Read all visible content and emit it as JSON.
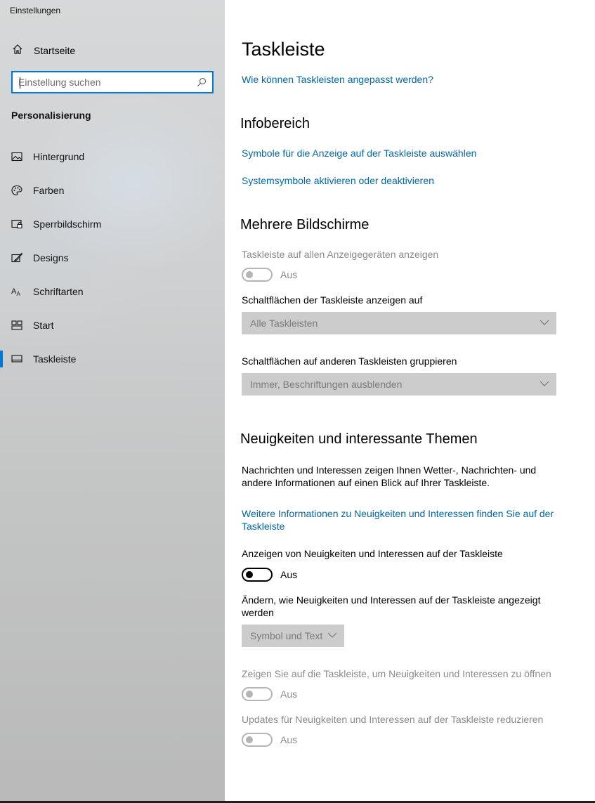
{
  "window": {
    "title": "Einstellungen"
  },
  "sidebar": {
    "home_label": "Startseite",
    "search": {
      "placeholder": "Einstellung suchen",
      "value": ""
    },
    "section_title": "Personalisierung",
    "items": [
      {
        "label": "Hintergrund",
        "icon": "image-icon",
        "selected": false
      },
      {
        "label": "Farben",
        "icon": "palette-icon",
        "selected": false
      },
      {
        "label": "Sperrbildschirm",
        "icon": "lock-screen-icon",
        "selected": false
      },
      {
        "label": "Designs",
        "icon": "brush-icon",
        "selected": false
      },
      {
        "label": "Schriftarten",
        "icon": "fonts-icon",
        "selected": false
      },
      {
        "label": "Start",
        "icon": "start-tiles-icon",
        "selected": false
      },
      {
        "label": "Taskleiste",
        "icon": "taskbar-icon",
        "selected": true
      }
    ]
  },
  "main": {
    "title": "Taskleiste",
    "help_link": "Wie können Taskleisten angepasst werden?",
    "notification_area": {
      "title": "Infobereich",
      "link_icons": "Symbole für die Anzeige auf der Taskleiste auswählen",
      "link_system_icons": "Systemsymbole aktivieren oder deaktivieren"
    },
    "multiple_displays": {
      "title": "Mehrere Bildschirme",
      "show_on_all_label": "Taskleiste auf allen Anzeigegeräten anzeigen",
      "show_on_all_state": "Aus",
      "buttons_on_label": "Schaltflächen der Taskleiste anzeigen auf",
      "buttons_on_value": "Alle Taskleisten",
      "combine_label": "Schaltflächen auf anderen Taskleisten gruppieren",
      "combine_value": "Immer, Beschriftungen ausblenden"
    },
    "news": {
      "title": "Neuigkeiten und interessante Themen",
      "description_line1": "Nachrichten und Interessen zeigen Ihnen Wetter-, Nachrichten- und",
      "description_line2": "andere Informationen auf einen Blick auf Ihrer Taskleiste.",
      "more_info_link_line1": "Weitere Informationen zu Neuigkeiten und Interessen finden Sie auf der",
      "more_info_link_line2": "Taskleiste",
      "show_label": "Anzeigen von Neuigkeiten und Interessen auf der Taskleiste",
      "show_state": "Aus",
      "change_label_line1": "Ändern, wie Neuigkeiten und Interessen auf der Taskleiste angezeigt",
      "change_label_line2": "werden",
      "change_value": "Symbol und Text",
      "hover_label": "Zeigen Sie auf die Taskleiste, um Neuigkeiten und Interessen zu öffnen",
      "hover_state": "Aus",
      "reduce_label": "Updates für Neuigkeiten und Interessen auf der Taskleiste reduzieren",
      "reduce_state": "Aus"
    }
  },
  "colors": {
    "accent": "#0078d7",
    "link": "#0067b8",
    "disabled_text": "#8a8a8a",
    "dropdown_bg": "#cccccc"
  }
}
